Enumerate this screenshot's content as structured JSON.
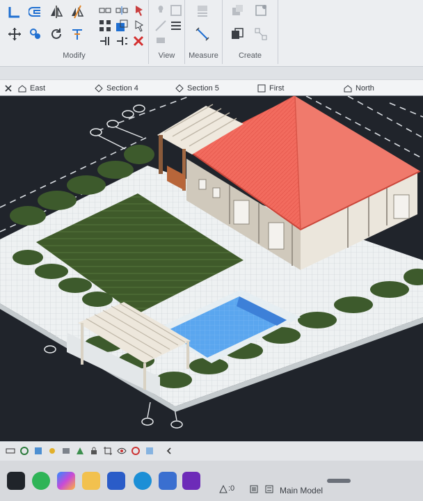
{
  "ribbon": {
    "panels": [
      {
        "title": "Modify"
      },
      {
        "title": "View"
      },
      {
        "title": "Measure"
      },
      {
        "title": "Create"
      }
    ]
  },
  "tabs": [
    {
      "label": "East",
      "icon": "house-icon"
    },
    {
      "label": "Section 4",
      "icon": "section-icon"
    },
    {
      "label": "Section 5",
      "icon": "section-icon"
    },
    {
      "label": "First",
      "icon": "plan-icon"
    },
    {
      "label": "North",
      "icon": "house-icon"
    }
  ],
  "status": {
    "scale_text": ":0",
    "model_label": "Main Model"
  },
  "colors": {
    "roof": "#f26b5e",
    "lawn": "#3f5a2a",
    "pool": "#5aa6ef",
    "paving": "#eef1f2",
    "hedge": "#3d5a2c",
    "canvas": "#20242b"
  }
}
